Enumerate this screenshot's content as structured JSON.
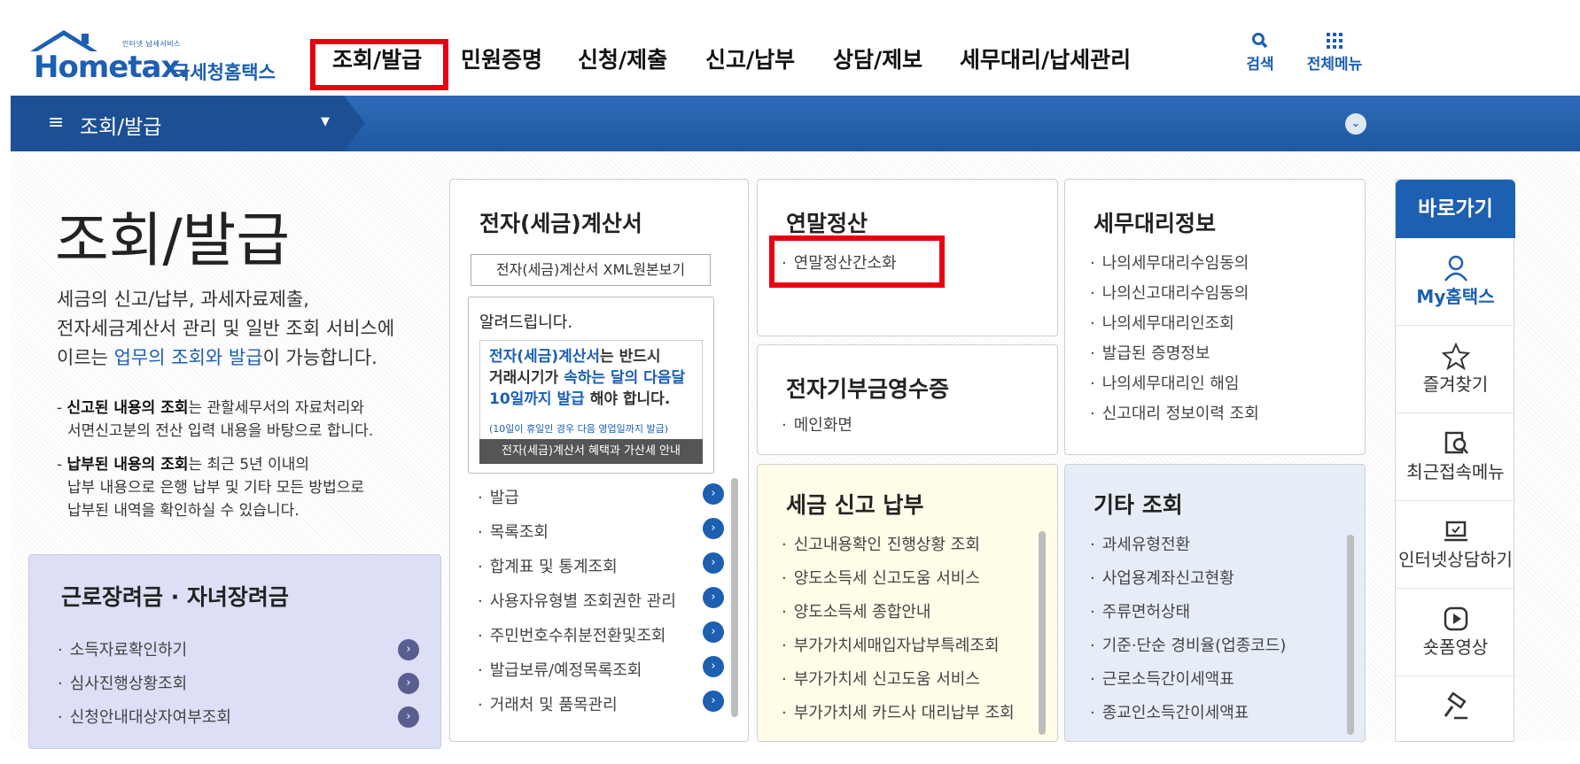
{
  "header": {
    "logo_small": "인터넷 납세서비스",
    "logo_en": "Hometax.",
    "logo_ko": "국세청홈택스",
    "nav": [
      "조회/발급",
      "민원증명",
      "신청/제출",
      "신고/납부",
      "상담/제보",
      "세무대리/납세관리"
    ],
    "search_label": "검색",
    "allmenu_label": "전체메뉴"
  },
  "breadcrumb": {
    "label": "조회/발급"
  },
  "intro": {
    "title": "조회/발급",
    "desc_1": "세금의 신고/납부, 과세자료제출,",
    "desc_2": "전자세금계산서 관리 및 일반 조회 서비스에",
    "desc_3a": "이르는 ",
    "desc_3b": "업무의 조회와 발급",
    "desc_3c": "이 가능합니다.",
    "note1_bold": "신고된 내용의 조회",
    "note1_rest": "는 관할세무서의 자료처리와",
    "note1_line2": "서면신고분의 전산 입력 내용을 바탕으로 합니다.",
    "note2_bold": "납부된 내용의 조회",
    "note2_rest": "는 최근 5년 이내의",
    "note2_line2": "납부 내용으로 은행 납부 및 기타 모든 방법으로",
    "note2_line3": "납부된 내역을 확인하실 수 있습니다."
  },
  "lavender": {
    "title": "근로장려금 · 자녀장려금",
    "items": [
      "소득자료확인하기",
      "심사진행상황조회",
      "신청안내대상자여부조회"
    ]
  },
  "einvoice": {
    "title": "전자(세금)계산서",
    "xml_button": "전자(세금)계산서 XML원본보기",
    "notice_title": "알려드립니다.",
    "notice_l1a": "전자(세금)계산서",
    "notice_l1b": "는 반드시",
    "notice_l2a": "거래시기가 ",
    "notice_l2b": "속하는 달의 다음달",
    "notice_l3a": "10일까지 발급",
    "notice_l3b": " 해야 합니다.",
    "notice_small": "(10일이 휴일인 경우 다음 영업일까지 발급)",
    "notice_button": "전자(세금)계산서 혜택과 가산세 안내",
    "items": [
      "발급",
      "목록조회",
      "합계표 및 통계조회",
      "사용자유형별 조회권한 관리",
      "주민번호수취분전환및조회",
      "발급보류/예정목록조회",
      "거래처 및 품목관리"
    ]
  },
  "yearend": {
    "title": "연말정산",
    "items": [
      "연말정산간소화"
    ]
  },
  "donation": {
    "title": "전자기부금영수증",
    "items": [
      "메인화면"
    ]
  },
  "tax_agent": {
    "title": "세무대리정보",
    "items": [
      "나의세무대리수임동의",
      "나의신고대리수임동의",
      "나의세무대리인조회",
      "발급된 증명정보",
      "나의세무대리인 해임",
      "신고대리 정보이력 조회"
    ]
  },
  "tax_report": {
    "title": "세금 신고 납부",
    "items": [
      "신고내용확인 진행상황 조회",
      "양도소득세 신고도움 서비스",
      "양도소득세 종합안내",
      "부가가치세매입자납부특례조회",
      "부가가치세 신고도움 서비스",
      "부가가치세 카드사 대리납부 조회"
    ]
  },
  "etc": {
    "title": "기타 조회",
    "items": [
      "과세유형전환",
      "사업용계좌신고현황",
      "주류면허상태",
      "기준·단순 경비율(업종코드)",
      "근로소득간이세액표",
      "종교인소득간이세액표"
    ]
  },
  "quick": {
    "title": "바로가기",
    "items": [
      {
        "label": "My홈택스",
        "icon": "person-icon"
      },
      {
        "label": "즐겨찾기",
        "icon": "star-icon"
      },
      {
        "label": "최근접속메뉴",
        "icon": "recent-menu-icon"
      },
      {
        "label": "인터넷상담하기",
        "icon": "laptop-icon"
      },
      {
        "label": "숏폼영상",
        "icon": "play-icon"
      },
      {
        "label": "",
        "icon": "gavel-icon"
      }
    ]
  },
  "colors": {
    "brand": "#1c5fb3",
    "highlight": "#e60012",
    "bar": "#1f58a3"
  }
}
